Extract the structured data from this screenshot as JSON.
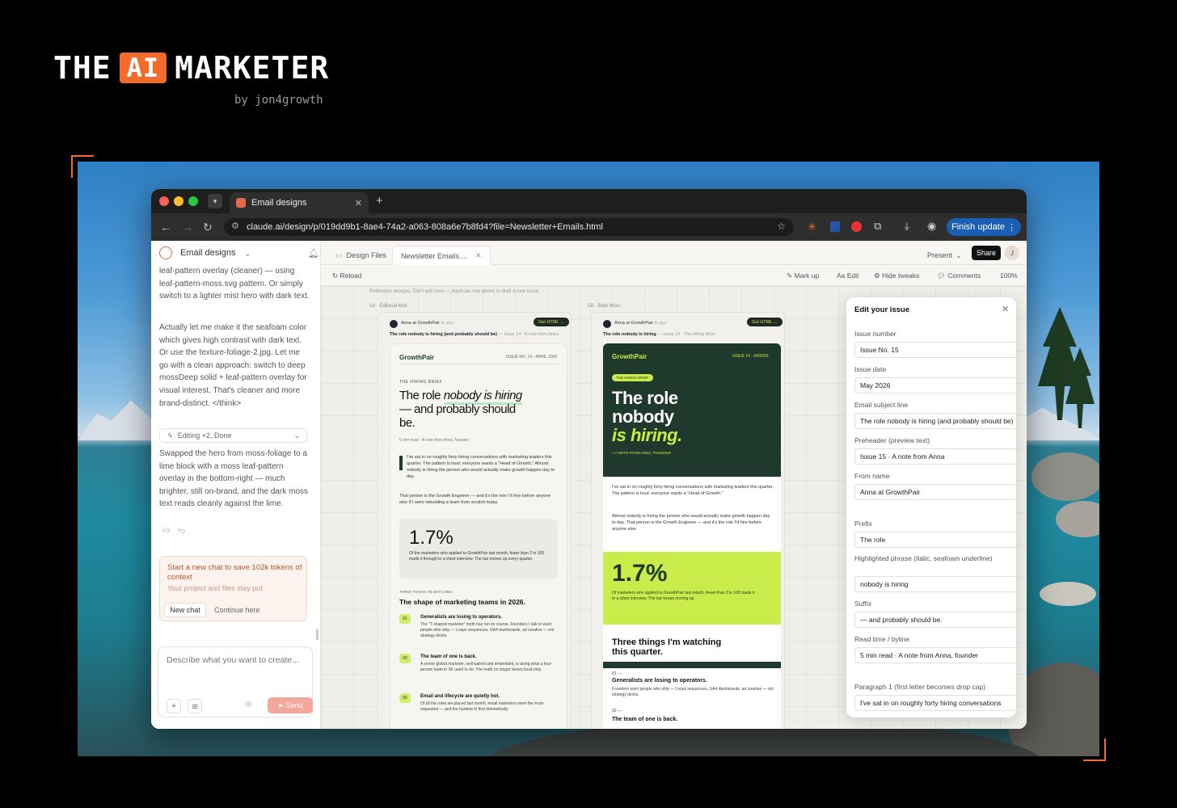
{
  "brand": {
    "the": "THE",
    "ai": "AI",
    "marketer": "MARKETER",
    "byline": "by jon4growth"
  },
  "browser": {
    "tab_title": "Email designs",
    "new_tab": "+",
    "url": "claude.ai/design/p/019dd9b1-8ae4-74a2-a063-808a6e7b8fd4?file=Newsletter+Emails.html",
    "finish_label": "Finish update"
  },
  "sidebar": {
    "project": "Email designs",
    "msg1": "leaf-pattern overlay (cleaner) — using leaf-pattern-moss.svg pattern. Or simply switch to a lighter mist hero with dark text.",
    "msg2": "Actually let me make it the seafoam color which gives high contrast with dark text. Or use the texture-foliage-2.jpg. Let me go with a clean approach: switch to deep mossDeep solid + leaf-pattern overlay for visual interest. That's cleaner and more brand-distinct. </think>",
    "editing": "Editing ×2, Done",
    "msg3": "Swapped the hero from moss-foliage to a lime block with a moss leaf-pattern overlay in the bottom-right — much brighter, still on-brand, and the dark moss text reads cleanly against the lime.",
    "notice_title": "Start a new chat to save 102k tokens of context",
    "notice_sub": "Your project and files stay put.",
    "new_chat": "New chat",
    "continue": "Continue here",
    "composer_placeholder": "Describe what you want to create...",
    "send": "Send"
  },
  "tabs": {
    "design_files": "Design Files",
    "newsletter": "Newsletter Emails....",
    "present": "Present",
    "share": "Share",
    "avatar": "J"
  },
  "toolbar": {
    "reload": "Reload",
    "markup": "Mark up",
    "edit": "Edit",
    "hide_tweaks": "Hide tweaks",
    "comments": "Comments",
    "zoom": "100%"
  },
  "canvas": {
    "note": "Reference designs. Don't edit here — duplicate one above to draft a new issue.",
    "a": {
      "label": "1A · Editorial Mist",
      "sender": "Anna at GrowthPair",
      "to": "to you",
      "get_html": "Get HTML →",
      "subject": "The role nobody is hiring (and probably should be)",
      "preheader": "— Issue 14 · A note from Anna",
      "logo": "GrowthPair",
      "issue": "ISSUE NO. 14 · APRIL 2026",
      "eyebrow": "THE HIRING BRIEF",
      "h_pre": "The role ",
      "h_hl": "nobody is hiring",
      "h_post": " — and probably should be.",
      "byline": "5 min read · A note from Anna, founder",
      "p1": "I've sat in on roughly forty hiring conversations with marketing leaders this quarter. The pattern is loud: everyone wants a \"Head of Growth.\" Almost nobody is hiring the person who would actually make growth happen day to day.",
      "p2": "That person is the Growth Engineer — and it's the role I'd hire before anyone else if I were rebuilding a team from scratch today.",
      "stat": "1.7%",
      "stat_text": "Of the marketers who applied to GrowthPair last month, fewer than 2 in 100 made it through to a client interview. The bar moves up every quarter.",
      "three": "THREE THINGS I'M WATCHING",
      "shape": "The shape of marketing teams in 2026.",
      "items": [
        {
          "n": "01",
          "t": "Generalists are losing to operators.",
          "d": "The \"T-shaped marketer\" myth has run its course. Founders I talk to want people who ship — Loops sequences, GA4 dashboards, ad creative — not strategy decks."
        },
        {
          "n": "02",
          "t": "The team of one is back.",
          "d": "A senior global marketer, well-paired and embedded, is doing what a four-person team in SF used to do. The math no longer favors local-only."
        },
        {
          "n": "03",
          "t": "Email and lifecycle are quietly hot.",
          "d": "Of all the roles we placed last month, email marketers were the most-requested — and the hardest to find domestically."
        }
      ]
    },
    "b": {
      "label": "1B · Bold Moss",
      "sender": "Anna at GrowthPair",
      "to": "to you",
      "get_html": "Get HTML →",
      "subject": "The role nobody is hiring",
      "preheader": "— Issue 14 · The Hiring Brief",
      "logo": "GrowthPair",
      "issue": "ISSUE 14 · 04/2026",
      "pill": "THE HIRING BRIEF",
      "h1": "The role",
      "h2": "nobody",
      "h3": "is hiring.",
      "note": "+ A NOTE FROM ANNA, FOUNDER",
      "p1": "I've sat in on roughly forty hiring conversations with marketing leaders this quarter. The pattern is loud: everyone wants a \"Head of Growth.\"",
      "p2": "Almost nobody is hiring the person who would actually make growth happen day to day. That person is the Growth Engineer — and it's the role I'd hire before anyone else.",
      "stat": "1.7%",
      "stat_text": "Of marketers who applied to GrowthPair last month, fewer than 2 in 100 made it to a client interview. The bar keeps moving up.",
      "three": "Three things I'm watching this quarter.",
      "i1n": "01 —",
      "i1t": "Generalists are losing to operators.",
      "i1d": "Founders want people who ship — Loops sequences, GA4 dashboards, ad creative — not strategy decks.",
      "i2n": "02 —",
      "i2t": "The team of one is back."
    }
  },
  "panel": {
    "title": "Edit your issue",
    "fields": [
      {
        "label": "Issue number",
        "value": "Issue No. 15"
      },
      {
        "label": "Issue date",
        "value": "May 2026"
      },
      {
        "label": "Email subject line",
        "value": "The role nobody is hiring (and probably should be)"
      },
      {
        "label": "Preheader (preview text)",
        "value": "Issue 15 · A note from Anna"
      },
      {
        "label": "From name",
        "value": "Anna at GrowthPair"
      },
      {
        "label": "Prefix",
        "value": "The role"
      },
      {
        "label": "Highlighted phrase (italic, seafoam underline)",
        "value": "nobody is hiring"
      },
      {
        "label": "Suffix",
        "value": "— and probably should be."
      },
      {
        "label": "Read time / byline",
        "value": "5 min read · A note from Anna, founder"
      },
      {
        "label": "Paragraph 1 (first letter becomes drop cap)",
        "value": "I've sat in on roughly forty hiring conversations"
      }
    ]
  },
  "colors": {
    "accent_orange": "#f26b2a",
    "finish_blue": "#1a5fb4",
    "moss": "#1f3a2c",
    "lime": "#c9ec4a"
  }
}
